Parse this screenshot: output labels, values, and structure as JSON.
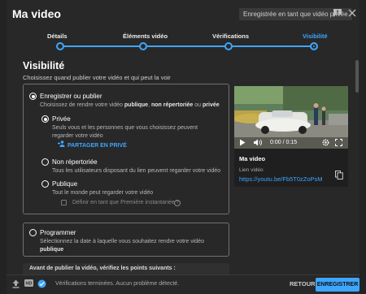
{
  "dialog": {
    "title": "Ma video",
    "saved_badge": "Enregistrée en tant que vidéo privée"
  },
  "steps": [
    {
      "label": "Détails"
    },
    {
      "label": "Éléments vidéo"
    },
    {
      "label": "Vérifications"
    },
    {
      "label": "Visibilité",
      "active": true
    }
  ],
  "visibility": {
    "title": "Visibilité",
    "subtitle": "Choisissez quand publier votre vidéo et qui peut la voir",
    "save_publish": {
      "label": "Enregistrer ou publier",
      "desc_prefix": "Choisissez de rendre votre vidéo ",
      "desc_bold_1": "publique",
      "desc_sep": ", ",
      "desc_bold_2": "non répertoriée",
      "desc_mid": " ou ",
      "desc_bold_3": "privée"
    },
    "private": {
      "label": "Privée",
      "desc": "Seuls vous et les personnes que vous choisissez peuvent regarder votre vidéo",
      "share_label": "PARTAGER EN PRIVÉ"
    },
    "unlisted": {
      "label": "Non répertoriée",
      "desc": "Tous les utilisateurs disposant du lien peuvent regarder votre vidéo"
    },
    "public": {
      "label": "Publique",
      "desc": "Tout le monde peut regarder votre vidéo",
      "premiere_label": "Définir en tant que Première instantanée"
    },
    "schedule": {
      "label": "Programmer",
      "desc_line1": "Sélectionnez la date à laquelle vous souhaitez rendre votre vidéo",
      "desc_bold": "publique"
    },
    "before_publish": "Avant de publier la vidéo, vérifiez les points suivants :"
  },
  "preview": {
    "time": "0:00 / 0:15",
    "video_title": "Ma video",
    "link_label": "Lien vidéo",
    "link": "https://youtu.be/Fb5T0zZoPsM"
  },
  "footer": {
    "status": "Vérifications terminées. Aucun problème détecté.",
    "hd_badge": "HD",
    "back_label": "RETOUR",
    "save_label": "ENREGISTRER"
  },
  "colors": {
    "accent": "#3ea6ff",
    "dialog_bg": "#282828"
  }
}
